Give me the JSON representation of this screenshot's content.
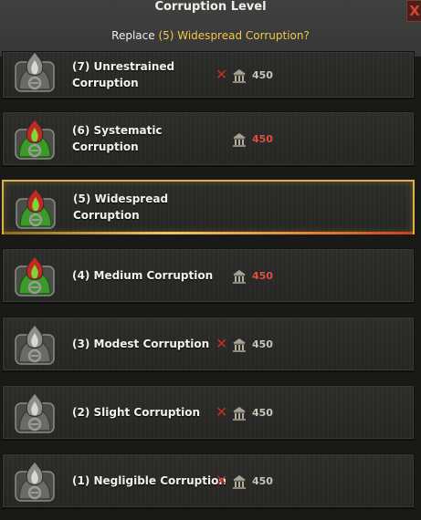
{
  "dialog": {
    "title": "Corruption Level",
    "prompt_prefix": "Replace",
    "prompt_highlight": "(5) Widespread Corruption?",
    "close_label": "X"
  },
  "rows": [
    {
      "label": "(7) Unrestrained Corruption",
      "cost": "450",
      "blocked": true,
      "active": false,
      "selected": false,
      "cost_color": "#c9c5b9"
    },
    {
      "label": "(6) Systematic Corruption",
      "cost": "450",
      "blocked": false,
      "active": true,
      "selected": false,
      "cost_color": "#e04e43"
    },
    {
      "label": "(5) Widespread Corruption",
      "cost": "",
      "blocked": false,
      "active": true,
      "selected": true,
      "cost_color": "#c9c5b9"
    },
    {
      "label": "(4) Medium Corruption",
      "cost": "450",
      "blocked": false,
      "active": true,
      "selected": false,
      "cost_color": "#e04e43"
    },
    {
      "label": "(3) Modest Corruption",
      "cost": "450",
      "blocked": true,
      "active": false,
      "selected": false,
      "cost_color": "#c9c5b9"
    },
    {
      "label": "(2) Slight Corruption",
      "cost": "450",
      "blocked": true,
      "active": false,
      "selected": false,
      "cost_color": "#c9c5b9"
    },
    {
      "label": "(1) Negligible Corruption",
      "cost": "450",
      "blocked": true,
      "active": false,
      "selected": false,
      "cost_color": "#c9c5b9"
    }
  ],
  "icons": {
    "blocked": "x-icon",
    "cost": "building-icon",
    "level": "flame-emblem-icon"
  },
  "colors": {
    "highlight": "#f2c94a",
    "accent_green": "#3f9b2a",
    "flame_red": "#c22a21"
  }
}
